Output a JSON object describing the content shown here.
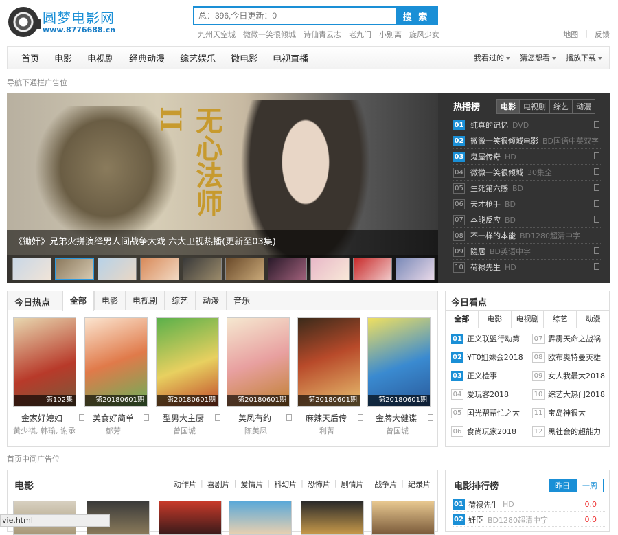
{
  "header": {
    "site_name": "圆梦电影网",
    "site_url": "www.8776688.cn",
    "search_placeholder": "总：396,今日更新：0",
    "search_button": "搜 索",
    "hot_words": [
      "九州天空城",
      "微微一笑很倾城",
      "诗仙青云志",
      "老九门",
      "小别离",
      "旋风少女"
    ],
    "top_links": [
      "地图",
      "反馈"
    ]
  },
  "nav": {
    "items": [
      "首页",
      "电影",
      "电视剧",
      "经典动漫",
      "综艺娱乐",
      "微电影",
      "电视直播"
    ],
    "right": [
      "我看过的",
      "猜您想看",
      "播放下载"
    ]
  },
  "ads": {
    "nav_ad": "导航下通栏广告位",
    "mid_ad": "首页中间广告位"
  },
  "banner": {
    "caption": "《锄奸》兄弟火拼演绎男人间战争大戏 六大卫视热播(更新至03集)",
    "art_text": "无心法师II"
  },
  "hot_rank": {
    "title": "热播榜",
    "tabs": [
      "电影",
      "电视剧",
      "综艺",
      "动漫"
    ],
    "items": [
      {
        "num": "01",
        "title": "纯真的记忆",
        "sub": "DVD"
      },
      {
        "num": "02",
        "title": "微微一笑很倾城电影",
        "sub": "BD国语中英双字"
      },
      {
        "num": "03",
        "title": "鬼屋传奇",
        "sub": "HD"
      },
      {
        "num": "04",
        "title": "微微一笑很倾城",
        "sub": "30集全"
      },
      {
        "num": "05",
        "title": "生死第六感",
        "sub": "BD"
      },
      {
        "num": "06",
        "title": "天才枪手",
        "sub": "BD"
      },
      {
        "num": "07",
        "title": "本能反应",
        "sub": "BD"
      },
      {
        "num": "08",
        "title": "不一样的本能",
        "sub": "BD1280超清中字"
      },
      {
        "num": "09",
        "title": "隐居",
        "sub": "BD英语中字"
      },
      {
        "num": "10",
        "title": "荷禄先生",
        "sub": "HD"
      }
    ]
  },
  "today_hot": {
    "title": "今日热点",
    "tabs": [
      "全部",
      "电影",
      "电视剧",
      "综艺",
      "动漫",
      "音乐"
    ],
    "items": [
      {
        "title": "金家好媳妇",
        "actor": "黄少祺, 韩瑜, 谢承",
        "ep": "第102集"
      },
      {
        "title": "美食好简单",
        "actor": "郁芳",
        "ep": "第20180601期"
      },
      {
        "title": "型男大主厨",
        "actor": "曾国城",
        "ep": "第20180601期"
      },
      {
        "title": "美凤有约",
        "actor": "陈美凤",
        "ep": "第20180601期"
      },
      {
        "title": "麻辣天后传",
        "actor": "利菁",
        "ep": "第20180601期"
      },
      {
        "title": "金牌大健谍",
        "actor": "曾国城",
        "ep": "第20180601期"
      }
    ]
  },
  "today_look": {
    "title": "今日看点",
    "tabs": [
      "全部",
      "电影",
      "电视剧",
      "综艺",
      "动漫"
    ],
    "items": [
      {
        "num": "01",
        "title": "正义联盟行动第"
      },
      {
        "num": "07",
        "title": "霹雳天命之战祸"
      },
      {
        "num": "02",
        "title": "¥T0姐妹会2018"
      },
      {
        "num": "08",
        "title": "欧布奥特曼英雄"
      },
      {
        "num": "03",
        "title": "正义检事"
      },
      {
        "num": "09",
        "title": "女人我最大2018"
      },
      {
        "num": "04",
        "title": "爱玩客2018"
      },
      {
        "num": "10",
        "title": "综艺大热门2018"
      },
      {
        "num": "05",
        "title": "国光帮帮忙之大"
      },
      {
        "num": "11",
        "title": "宝岛神很大"
      },
      {
        "num": "06",
        "title": "食尚玩家2018"
      },
      {
        "num": "12",
        "title": "黑社会的超能力"
      }
    ]
  },
  "movie_section": {
    "title": "电影",
    "cats": [
      "动作片",
      "喜剧片",
      "爱情片",
      "科幻片",
      "恐怖片",
      "剧情片",
      "战争片",
      "纪录片"
    ]
  },
  "movie_rank": {
    "title": "电影排行榜",
    "tabs": [
      "昨日",
      "一周"
    ],
    "items": [
      {
        "num": "01",
        "title": "荷禄先生",
        "sub": "HD",
        "score": "0.0"
      },
      {
        "num": "02",
        "title": "奸臣",
        "sub": "BD1280超清中字",
        "score": "0.0"
      }
    ]
  },
  "status_bar": "vie.html",
  "colors": {
    "accent": "#1a8fd6",
    "dark_panel": "#333333",
    "score": "#ee3333"
  }
}
